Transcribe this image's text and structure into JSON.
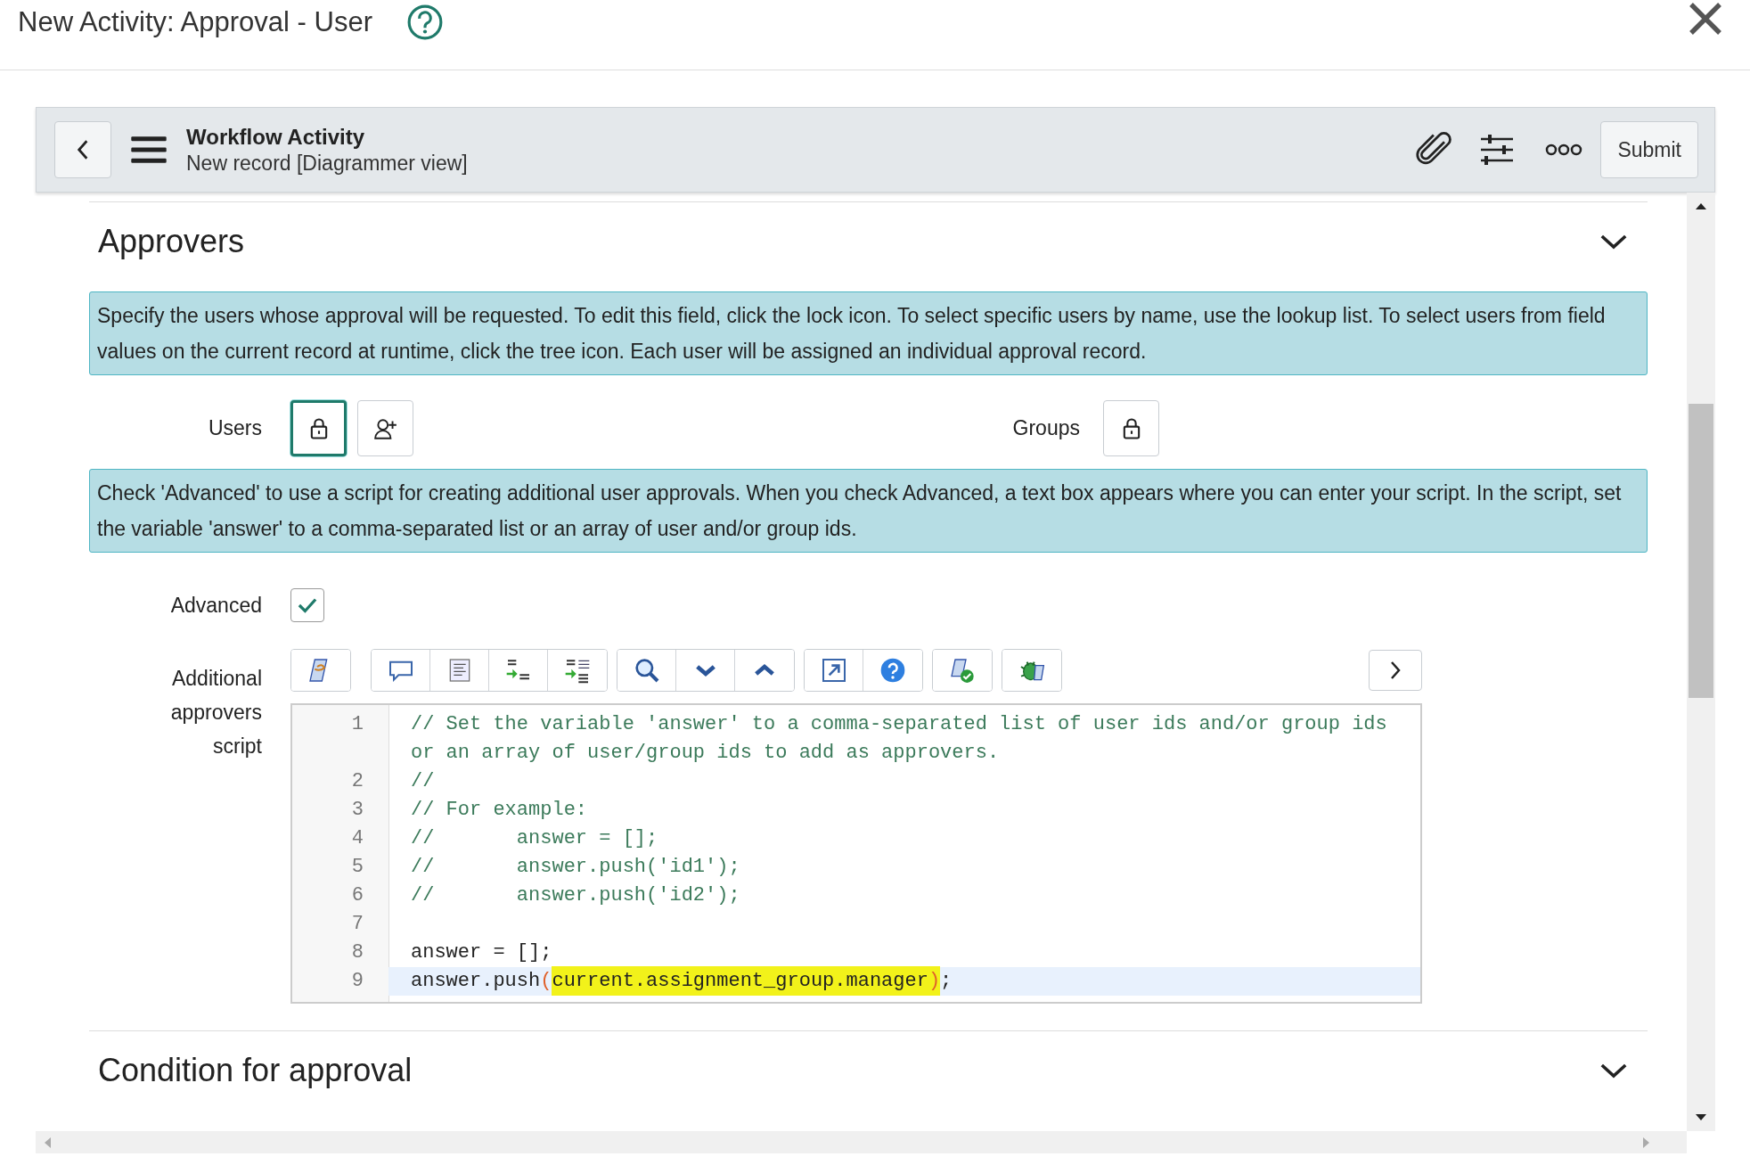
{
  "dialog": {
    "title": "New Activity: Approval - User"
  },
  "form_header": {
    "title": "Workflow Activity",
    "subtitle": "New record [Diagrammer view]",
    "submit": "Submit"
  },
  "approvers": {
    "title": "Approvers",
    "users_help": "Specify the users whose approval will be requested. To edit this field, click the lock icon. To select specific users by name, use the lookup list. To select users from field values on the current record at runtime, click the tree icon. Each user will be assigned an individual approval record.",
    "users": {
      "label": "Users",
      "focused": true
    },
    "groups": {
      "label": "Groups",
      "focused": false
    },
    "advanced_help": "Check 'Advanced' to use a script for creating additional user approvals. When you check Advanced, a text box appears where you can enter your script. In the script, set the variable 'answer' to a comma-separated list or an array of user and/or group ids.",
    "advanced": {
      "label": "Advanced",
      "checked": true
    },
    "script": {
      "label": "Additional approvers script",
      "lines": [
        {
          "number": "1",
          "selected": false,
          "tokens": [
            {
              "kind": "comment",
              "text": "// Set the variable 'answer' to a comma-separated list of user ids and/or group ids or an array of user/group ids to add as approvers."
            }
          ]
        },
        {
          "number": "2",
          "selected": false,
          "tokens": [
            {
              "kind": "comment",
              "text": "//"
            }
          ]
        },
        {
          "number": "3",
          "selected": false,
          "tokens": [
            {
              "kind": "comment",
              "text": "// For example:"
            }
          ]
        },
        {
          "number": "4",
          "selected": false,
          "tokens": [
            {
              "kind": "comment",
              "text": "//       answer = [];"
            }
          ]
        },
        {
          "number": "5",
          "selected": false,
          "tokens": [
            {
              "kind": "comment",
              "text": "//       answer.push('id1');"
            }
          ]
        },
        {
          "number": "6",
          "selected": false,
          "tokens": [
            {
              "kind": "comment",
              "text": "//       answer.push('id2');"
            }
          ]
        },
        {
          "number": "7",
          "selected": false
        },
        {
          "number": "8",
          "selected": false,
          "tokens": [
            {
              "kind": "code",
              "text": "answer = [];"
            }
          ]
        },
        {
          "number": "9",
          "selected": true,
          "tokens": [
            {
              "kind": "code",
              "text": "answer.push"
            },
            {
              "kind": "bracket",
              "text": "("
            },
            {
              "kind": "code",
              "text": "current.assignment_group.manager",
              "highlighted": true
            },
            {
              "kind": "bracket",
              "text": ")",
              "highlighted": true
            },
            {
              "kind": "code",
              "text": ";"
            }
          ]
        }
      ]
    }
  },
  "condition": {
    "title": "Condition for approval"
  }
}
